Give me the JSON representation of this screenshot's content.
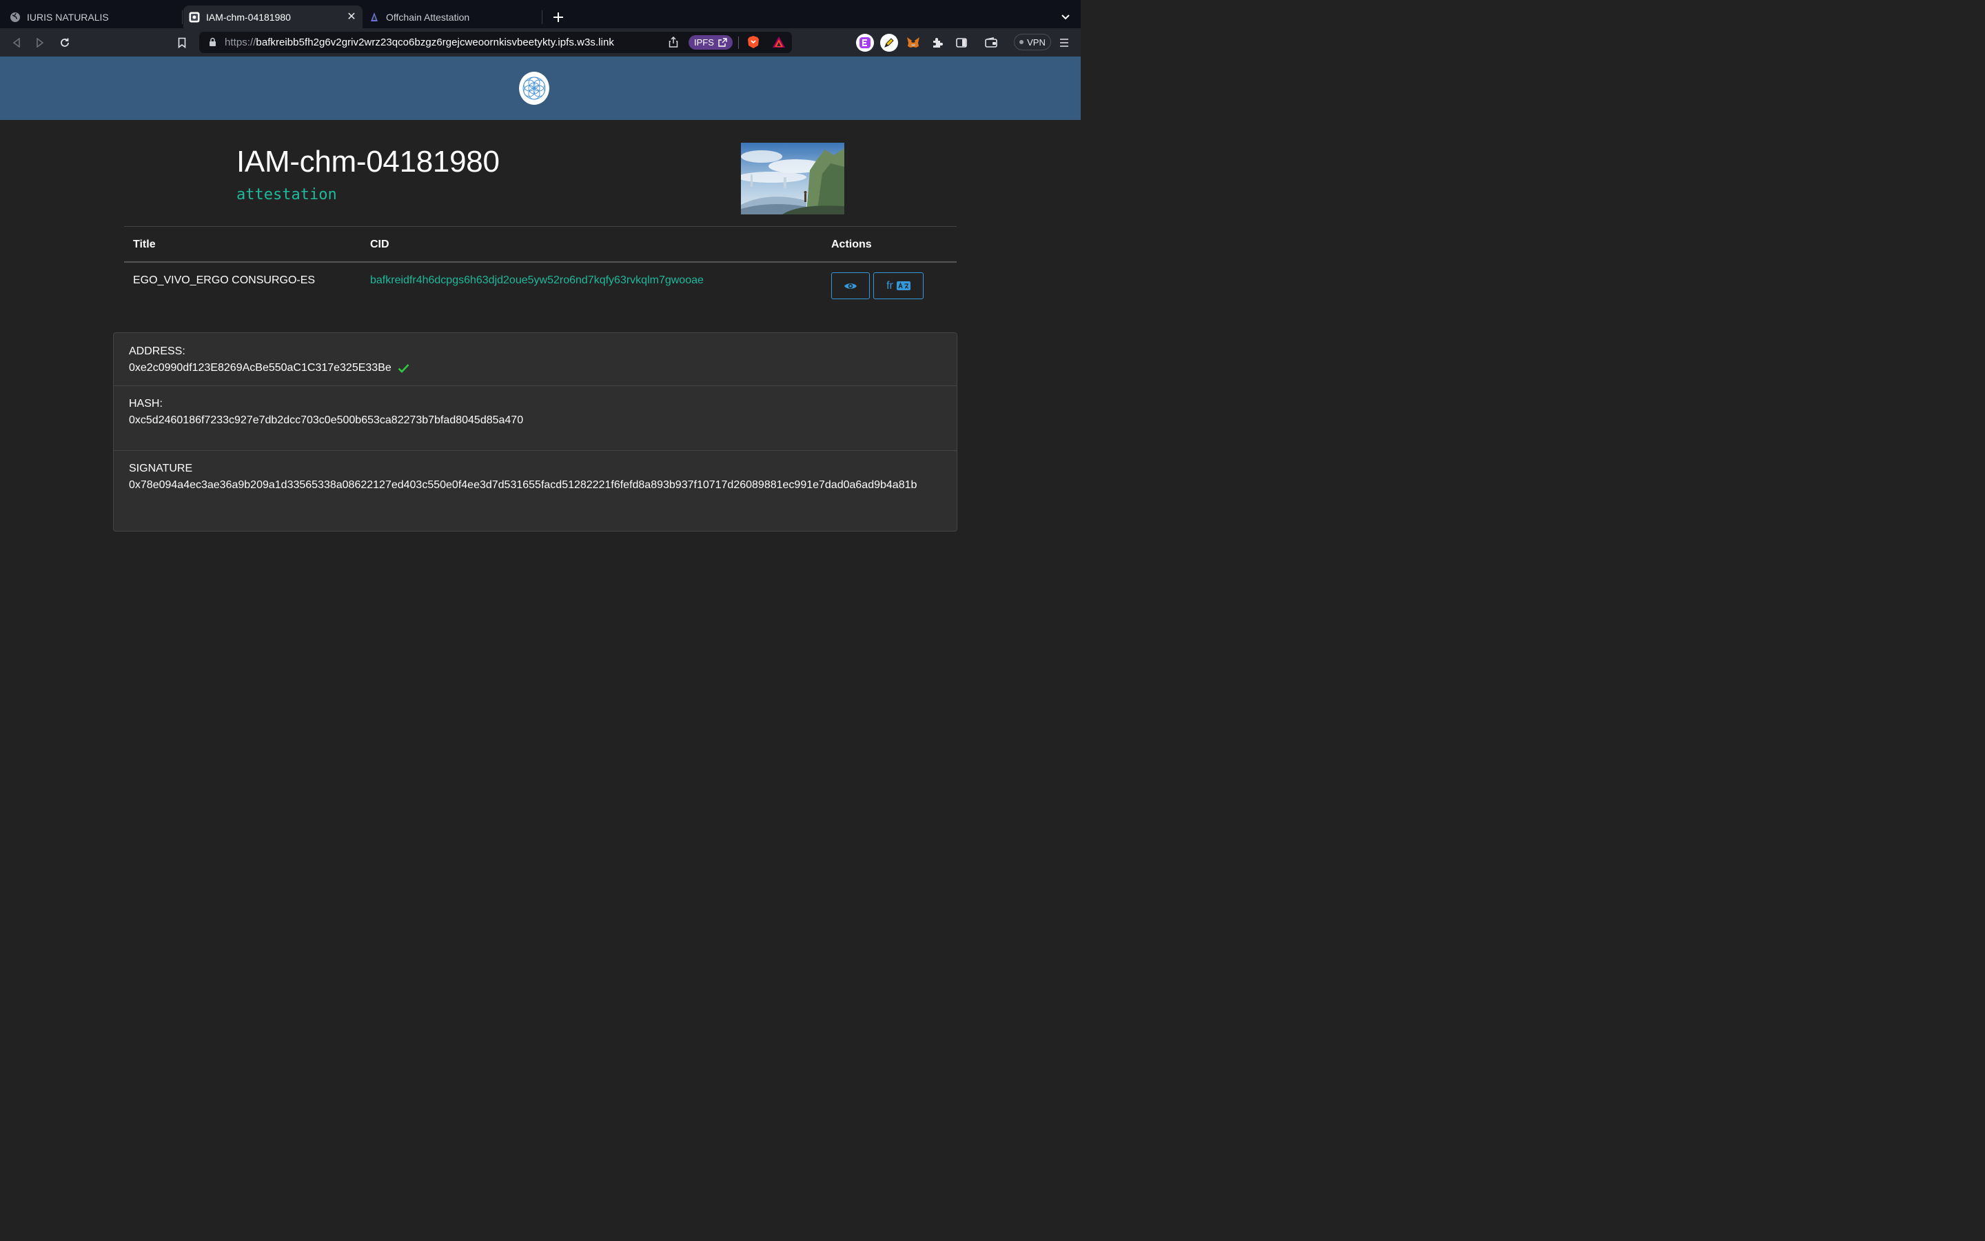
{
  "browser": {
    "tabs": [
      {
        "label": "IURIS NATURALIS",
        "active": false
      },
      {
        "label": "IAM-chm-04181980",
        "active": true
      },
      {
        "label": "Offchain Attestation",
        "active": false
      }
    ],
    "url_scheme": "https://",
    "url_host": "bafkreibb5fh2g6v2griv2wrz23qco6bzgz6rgejcweoornkisvbeetykty.ipfs.w3s.link",
    "ipfs_label": "IPFS",
    "vpn_label": "VPN"
  },
  "page": {
    "title": "IAM-chm-04181980",
    "subtitle": "attestation"
  },
  "table": {
    "headers": {
      "title": "Title",
      "cid": "CID",
      "actions": "Actions"
    },
    "rows": [
      {
        "title": "EGO_VIVO_ERGO CONSURGO-ES",
        "cid": "bafkreidfr4h6dcpgs6h63djd2oue5yw52ro6nd7kqfy63rvkqlm7gwooae",
        "lang_button": "fr"
      }
    ]
  },
  "attestation": {
    "address_label": "ADDRESS:",
    "address": "0xe2c0990df123E8269AcBe550aC1C317e325E33Be",
    "hash_label": "HASH:",
    "hash": "0xc5d2460186f7233c927e7db2dcc703c0e500b653ca82273b7bfad8045d85a470",
    "signature_label": "SIGNATURE",
    "signature": "0x78e094a4ec3ae36a9b209a1d33565338a08622127ed403c550e0f4ee3d7d531655facd51282221f6fefd8a893b937f10717d26089881ec991e7dad0a6ad9b4a81b"
  },
  "colors": {
    "header_bg": "#375a7f",
    "accent_green": "#1fb89a",
    "action_blue": "#3498db",
    "check_green": "#2ecc40"
  },
  "icons": {
    "verified": "check-icon",
    "view": "eye-icon",
    "translate": "translate-icon"
  }
}
